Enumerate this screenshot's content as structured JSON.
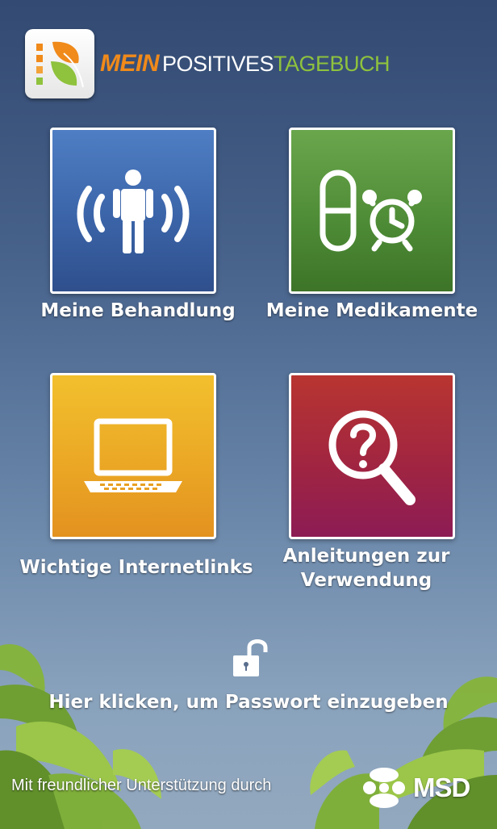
{
  "header": {
    "logo_mein": "Mein",
    "logo_positives": "POSITIVES",
    "logo_tagebuch": "TAGEBUCH"
  },
  "menu": {
    "tiles": [
      {
        "label": "Meine Behandlung",
        "icon": "person-signal-icon",
        "color": "#3b64a8"
      },
      {
        "label": "Meine Medikamente",
        "icon": "pill-alarm-clock-icon",
        "color": "#4d8a35"
      },
      {
        "label": "Wichtige Internetlinks",
        "icon": "laptop-icon",
        "color": "#eaa524"
      },
      {
        "label_line1": "Anleitungen zur",
        "label_line2": "Verwendung",
        "icon": "magnifier-question-icon",
        "color": "#a12541"
      }
    ]
  },
  "password": {
    "icon": "unlock-icon",
    "label": "Hier klicken, um Passwort einzugeben"
  },
  "footer": {
    "support_text": "Mit freundlicher Unterstützung durch",
    "sponsor": "MSD"
  }
}
